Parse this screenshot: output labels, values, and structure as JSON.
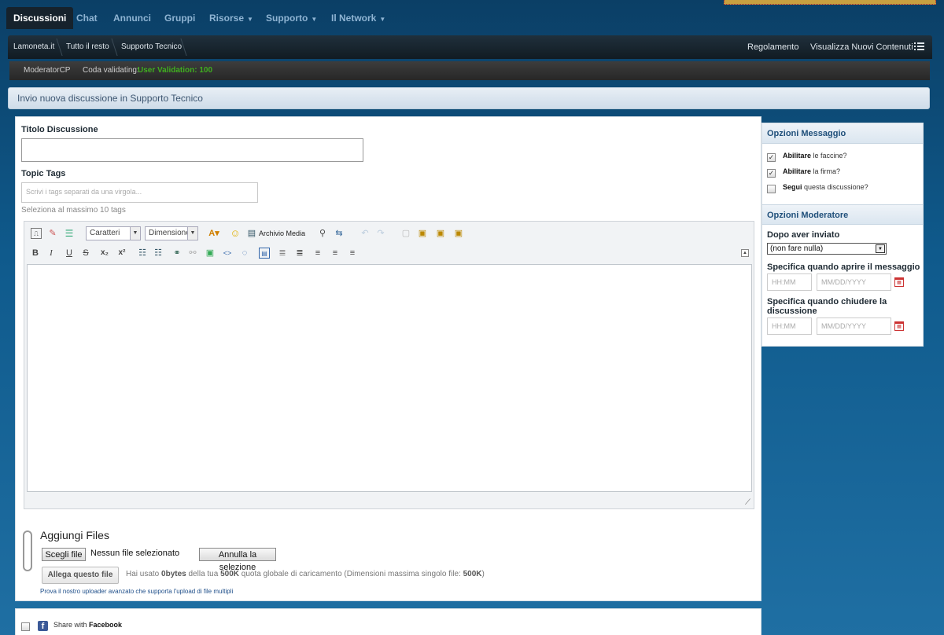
{
  "nav": {
    "items": [
      {
        "label": "Discussioni",
        "active": true
      },
      {
        "label": "Chat"
      },
      {
        "label": "Annunci"
      },
      {
        "label": "Gruppi"
      },
      {
        "label": "Risorse",
        "dropdown": true
      },
      {
        "label": "Supporto",
        "dropdown": true
      },
      {
        "label": "Il Network",
        "dropdown": true
      }
    ]
  },
  "breadcrumb": [
    "Lamoneta.it",
    "Tutto il resto",
    "Supporto Tecnico"
  ],
  "header_links": {
    "rules": "Regolamento",
    "new_content": "Visualizza Nuovi Contenuti"
  },
  "modbar": {
    "moderatorcp": "ModeratorCP",
    "queue_label": "Coda validating:",
    "queue_value": "User Validation: 100"
  },
  "page_title": "Invio nuova discussione in Supporto Tecnico",
  "form": {
    "title_label": "Titolo Discussione",
    "title_value": "",
    "tags_label": "Topic Tags",
    "tags_placeholder": "Scrivi i tags separati da una virgola...",
    "tags_hint": "Seleziona al massimo 10 tags"
  },
  "editor": {
    "font_select": "Caratteri",
    "size_select": "Dimensione",
    "media_label": "Archivio Media",
    "toolbar_row1": [
      "remove-format-icon",
      "eraser-icon",
      "switch-mode-icon"
    ],
    "toolbar_row2": [
      "bold-icon",
      "italic-icon",
      "underline-icon",
      "strike-icon",
      "subscript-icon",
      "superscript-icon",
      "ordered-list-icon",
      "unordered-list-icon",
      "link-icon",
      "unlink-icon",
      "image-icon",
      "code-icon",
      "quote-icon",
      "table-icon",
      "align-left-icon",
      "align-center-icon",
      "align-right-icon",
      "justify-icon",
      "indent-icon"
    ]
  },
  "files": {
    "title": "Aggiungi Files",
    "choose_btn": "Scegli file",
    "no_file": "Nessun file selezionato",
    "cancel_btn": "Annulla la selezione",
    "attach_btn": "Allega questo file",
    "usage_prefix": "Hai usato",
    "usage_used": "0bytes",
    "usage_mid": "della tua",
    "usage_quota": "500K",
    "usage_mid2": "quota globale di caricamento (Dimensioni massima singolo file:",
    "usage_max": "500K",
    "usage_end": ")",
    "advanced_link": "Prova il nostro uploader avanzato che supporta l'upload di file multipli"
  },
  "share": {
    "prefix": "Share with",
    "network": "Facebook"
  },
  "sidebar": {
    "options_title": "Opzioni Messaggio",
    "options": [
      {
        "bold": "Abilitare",
        "rest": "le faccine?",
        "checked": true
      },
      {
        "bold": "Abilitare",
        "rest": "la firma?",
        "checked": true
      },
      {
        "bold": "Segui",
        "rest": "questa discussione?",
        "checked": false
      }
    ],
    "mod_title": "Opzioni Moderatore",
    "after_post_label": "Dopo aver inviato",
    "after_post_value": "(non fare nulla)",
    "open_label": "Specifica quando aprire il messaggio",
    "close_label": "Specifica quando chiudere la discussione",
    "time_placeholder": "HH:MM",
    "date_placeholder": "MM/DD/YYYY"
  }
}
